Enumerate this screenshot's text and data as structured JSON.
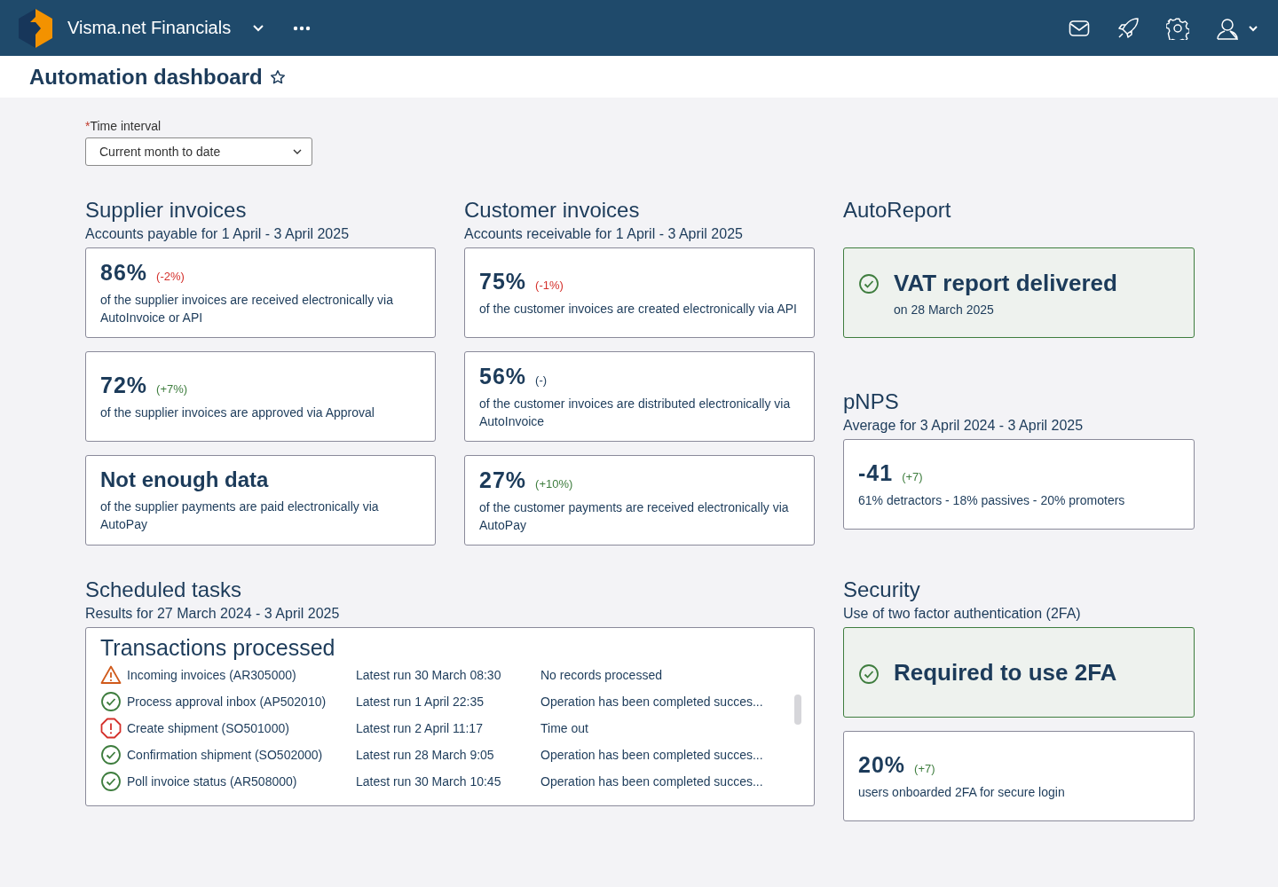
{
  "app": {
    "name": "Visma.net Financials"
  },
  "page": {
    "title": "Automation dashboard",
    "favorite": false
  },
  "time_interval": {
    "required_mark": "*",
    "label": "Time interval",
    "value": "Current month to date"
  },
  "columns": [
    {
      "title": "Supplier invoices",
      "subtitle": "Accounts payable for 1 April - 3 April 2025",
      "cards": [
        {
          "kind": "metric",
          "value": "86%",
          "change": "(-2%)",
          "color": "#d4302b",
          "text": "of the supplier invoices are received electronically via AutoInvoice or API"
        },
        {
          "kind": "metric",
          "value": "72%",
          "change": "(+7%)",
          "color": "#3e7d3e",
          "text": "of the supplier invoices are approved via Approval"
        },
        {
          "kind": "nodata",
          "value": "Not enough data",
          "text": "of the supplier payments are paid electronically via AutoPay"
        }
      ]
    },
    {
      "title": "Customer invoices",
      "subtitle": "Accounts receivable  for 1 April - 3 April 2025",
      "cards": [
        {
          "kind": "metric",
          "value": "75%",
          "change": "(-1%)",
          "color": "#d4302b",
          "text": "of the customer invoices are created electronically via API"
        },
        {
          "kind": "metric",
          "value": "56%",
          "change": "(-)",
          "color": "#1c3b5a",
          "text": "of the customer invoices are distributed electronically via AutoInvoice"
        },
        {
          "kind": "metric",
          "value": "27%",
          "change": "(+10%)",
          "color": "#3e7d3e",
          "text": "of the customer payments are received electronically via AutoPay"
        }
      ]
    },
    {
      "title": "AutoReport",
      "cards": [
        {
          "kind": "success",
          "value": "VAT report delivered",
          "text": "on 28 March 2025"
        }
      ]
    },
    {
      "title": "pNPS",
      "subtitle": "Average for 3 April 2024 - 3 April 2025",
      "cards": [
        {
          "kind": "metric",
          "value": "-41",
          "change": "(+7)",
          "color": "#3e7d3e",
          "text": "61% detractors - 18% passives - 20% promoters"
        }
      ]
    }
  ],
  "scheduled_tasks": {
    "title": "Scheduled tasks",
    "subtitle": "Results for 27 March 2024 - 3 April 2025",
    "panel_title": "Transactions processed",
    "rows": [
      {
        "kind": "warning",
        "name": "Incoming invoices (AR305000)",
        "run": "Latest run 30 March 08:30",
        "result": "No records processed"
      },
      {
        "kind": "success",
        "name": "Process approval inbox (AP502010)",
        "run": "Latest run 1 April 22:35",
        "result": "Operation has been completed succes..."
      },
      {
        "kind": "error",
        "name": "Create shipment (SO501000)",
        "run": "Latest run 2 April 11:17",
        "result": "Time out"
      },
      {
        "kind": "success",
        "name": "Confirmation shipment (SO502000)",
        "run": "Latest run 28 March 9:05",
        "result": "Operation has been completed succes..."
      },
      {
        "kind": "success",
        "name": "Poll invoice status (AR508000)",
        "run": "Latest run 30 March 10:45",
        "result": "Operation has been completed succes..."
      }
    ]
  },
  "security": {
    "title": "Security",
    "subtitle": "Use of two factor authentication (2FA)",
    "cards": [
      {
        "kind": "success",
        "value": "Required to use 2FA"
      },
      {
        "kind": "metric",
        "value": "20%",
        "change": "(+7)",
        "color": "#3e7d3e",
        "text": "users onboarded 2FA for secure login"
      }
    ]
  }
}
